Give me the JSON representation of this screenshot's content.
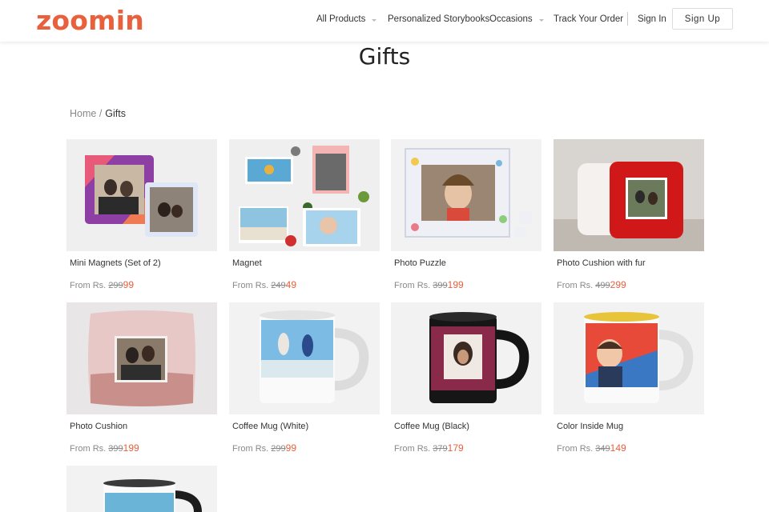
{
  "header": {
    "logo": "zoomin",
    "nav": [
      {
        "label": "All Products",
        "dropdown": true
      },
      {
        "label": "Personalized Storybooks",
        "dropdown": false
      },
      {
        "label": "Occasions",
        "dropdown": true
      },
      {
        "label": "Track Your Order",
        "dropdown": false
      },
      {
        "label": "Sign In",
        "dropdown": false
      }
    ],
    "signup": "Sign Up"
  },
  "page": {
    "title": "Gifts"
  },
  "breadcrumb": {
    "home": "Home /",
    "current": "Gifts"
  },
  "products": [
    {
      "name": "Mini Magnets (Set of 2)",
      "from": "From Rs.",
      "old": "299",
      "new": "99"
    },
    {
      "name": "Magnet",
      "from": "From Rs.",
      "old": "249",
      "new": "49"
    },
    {
      "name": "Photo Puzzle",
      "from": "From Rs.",
      "old": "399",
      "new": "199"
    },
    {
      "name": "Photo Cushion with fur",
      "from": "From Rs.",
      "old": "499",
      "new": "299"
    },
    {
      "name": "Photo Cushion",
      "from": "From Rs.",
      "old": "399",
      "new": "199"
    },
    {
      "name": "Coffee Mug (White)",
      "from": "From Rs.",
      "old": "299",
      "new": "99"
    },
    {
      "name": "Coffee Mug (Black)",
      "from": "From Rs.",
      "old": "379",
      "new": "179"
    },
    {
      "name": "Color Inside Mug",
      "from": "From Rs.",
      "old": "349",
      "new": "149"
    }
  ],
  "colors": {
    "brand": "#e8603c",
    "text": "#333333",
    "muted": "#888888"
  }
}
